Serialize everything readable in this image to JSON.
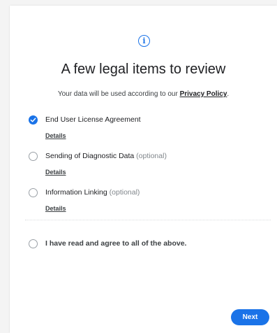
{
  "dialog": {
    "title": "A few legal items to review",
    "subtitle_prefix": "Your data will be used according to our ",
    "privacy_link": "Privacy Policy",
    "subtitle_suffix": "."
  },
  "items": [
    {
      "label": "End User License Agreement",
      "optional": "",
      "details": "Details",
      "checked": true
    },
    {
      "label": "Sending of Diagnostic Data",
      "optional": "(optional)",
      "details": "Details",
      "checked": false
    },
    {
      "label": "Information Linking",
      "optional": "(optional)",
      "details": "Details",
      "checked": false
    }
  ],
  "agree_all": {
    "label": "I have read and agree to all of the above.",
    "checked": false
  },
  "next_button": {
    "label": "Next"
  },
  "colors": {
    "accent": "#1a73e8",
    "text": "#202124",
    "muted": "#80868b"
  },
  "icons": {
    "header": "info-icon",
    "checked": "check-icon"
  }
}
